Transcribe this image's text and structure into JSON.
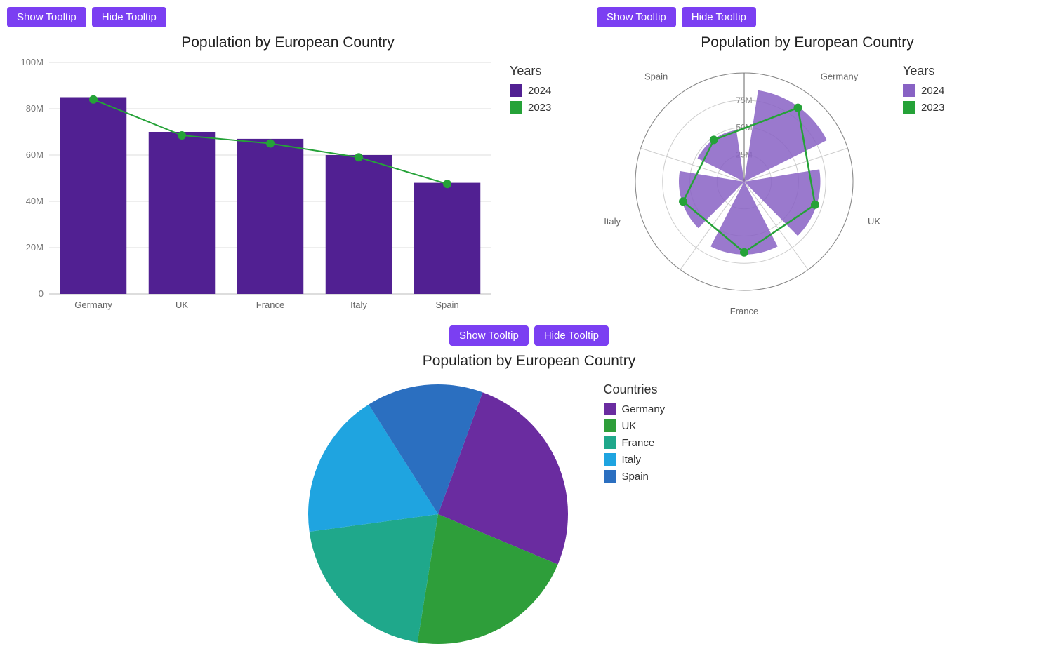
{
  "buttons": {
    "show": "Show Tooltip",
    "hide": "Hide Tooltip"
  },
  "chart_data": [
    {
      "id": "bar",
      "type": "bar",
      "title": "Population by European Country",
      "categories": [
        "Germany",
        "UK",
        "France",
        "Italy",
        "Spain"
      ],
      "ylim": [
        0,
        100000000
      ],
      "yticks": [
        0,
        20000000,
        40000000,
        60000000,
        80000000,
        100000000
      ],
      "ytick_labels": [
        "0",
        "20M",
        "40M",
        "60M",
        "80M",
        "100M"
      ],
      "legend_title": "Years",
      "series": [
        {
          "name": "2024",
          "type": "column",
          "color": "#512092",
          "values": [
            85000000,
            70000000,
            67000000,
            60000000,
            48000000
          ]
        },
        {
          "name": "2023",
          "type": "line",
          "color": "#25a238",
          "values": [
            84000000,
            68500000,
            65000000,
            59000000,
            47500000
          ]
        }
      ]
    },
    {
      "id": "polar",
      "type": "polar",
      "title": "Population by European Country",
      "categories": [
        "Germany",
        "UK",
        "France",
        "Italy",
        "Spain"
      ],
      "rlim": [
        0,
        100000000
      ],
      "rticks": [
        25000000,
        50000000,
        75000000
      ],
      "rtick_labels": [
        "25M",
        "50M",
        "75M"
      ],
      "legend_title": "Years",
      "series": [
        {
          "name": "2024",
          "type": "column",
          "color": "#8862c4",
          "values": [
            85000000,
            70000000,
            67000000,
            60000000,
            48000000
          ]
        },
        {
          "name": "2023",
          "type": "line",
          "color": "#25a238",
          "values": [
            84000000,
            68500000,
            65000000,
            59000000,
            47500000
          ]
        }
      ]
    },
    {
      "id": "pie",
      "type": "pie",
      "title": "Population by European Country",
      "legend_title": "Countries",
      "categories": [
        "Germany",
        "UK",
        "France",
        "Italy",
        "Spain"
      ],
      "values": [
        85000000,
        70000000,
        67000000,
        60000000,
        48000000
      ],
      "colors": [
        "#6a2ca0",
        "#2e9e3a",
        "#1fa88b",
        "#1fa4e0",
        "#2b6fc0"
      ]
    }
  ]
}
